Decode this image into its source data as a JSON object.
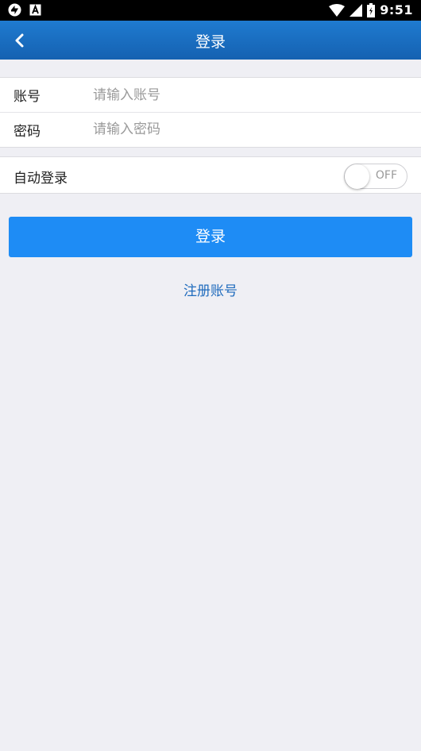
{
  "status_bar": {
    "time": "9:51",
    "left_icons": [
      "sync-icon",
      "app-a-icon"
    ],
    "right_icons": [
      "wifi-icon",
      "signal-icon",
      "battery-icon"
    ]
  },
  "app_bar": {
    "title": "登录",
    "back_icon": "chevron-left-icon",
    "color": "#1a6ec2"
  },
  "form": {
    "account_label": "账号",
    "account_placeholder": "请输入账号",
    "account_value": "",
    "password_label": "密码",
    "password_placeholder": "请输入密码",
    "password_value": ""
  },
  "auto_login": {
    "label": "自动登录",
    "toggle_state": "OFF"
  },
  "login_button": {
    "label": "登录",
    "color": "#1e8cf5"
  },
  "register_link": {
    "label": "注册账号",
    "color": "#1f6bbd"
  }
}
